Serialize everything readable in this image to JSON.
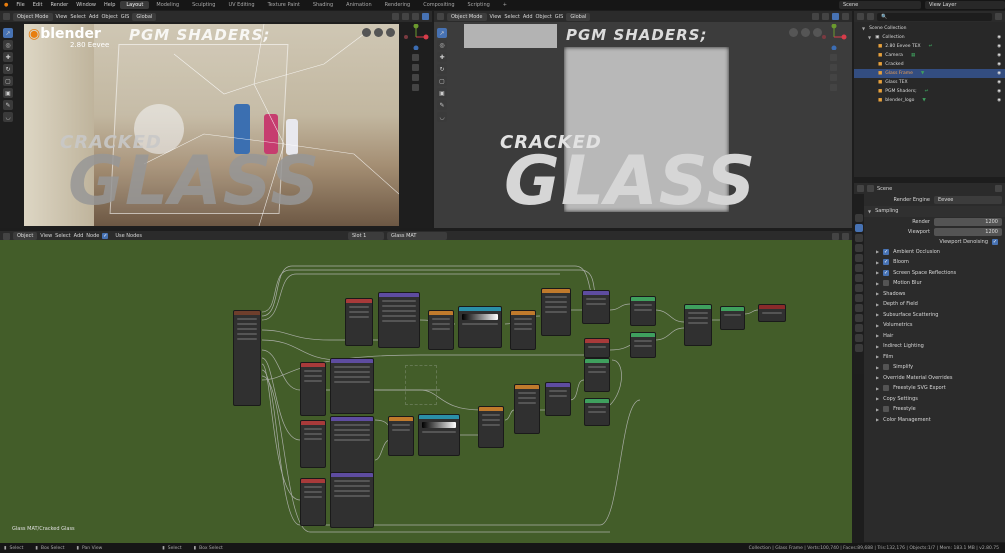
{
  "menu": {
    "items": [
      "File",
      "Edit",
      "Render",
      "Window",
      "Help"
    ]
  },
  "workspaces": [
    "Layout",
    "Modeling",
    "Sculpting",
    "UV Editing",
    "Texture Paint",
    "Shading",
    "Animation",
    "Rendering",
    "Compositing",
    "Scripting"
  ],
  "scene": {
    "name": "Scene",
    "view_layer": "View Layer"
  },
  "viewport_left": {
    "mode": "Object Mode",
    "menus": [
      "View",
      "Select",
      "Add",
      "Object",
      "GIS"
    ],
    "orientation": "Global",
    "logo": "blender",
    "version": "2.80 Eevee",
    "title": "PGM SHADERS;",
    "label_small": "CRACKED",
    "label_big": "GLASS"
  },
  "viewport_right": {
    "mode": "Object Mode",
    "menus": [
      "View",
      "Select",
      "Add",
      "Object",
      "GIS"
    ],
    "orientation": "Global",
    "title": "PGM SHADERS;",
    "label_small": "CRACKED",
    "label_big": "GLASS"
  },
  "node_editor": {
    "type": "Object",
    "menus": [
      "View",
      "Select",
      "Add",
      "Node"
    ],
    "use_nodes": "Use Nodes",
    "slot": "Slot 1",
    "material": "Glass MAT",
    "breadcrumb": "Glass MAT/Cracked Glass"
  },
  "outliner": {
    "root": "Scene Collection",
    "items": [
      "Collection",
      "2.80 Eevee TEX",
      "Camera",
      "Cracked",
      "Glass Frame",
      "Glass TEX",
      "PGM Shaders;",
      "blender_logo"
    ]
  },
  "properties": {
    "scene_label": "Scene",
    "render_engine_label": "Render Engine",
    "render_engine": "Eevee",
    "sampling": "Sampling",
    "render_label": "Render",
    "render_value": "1200",
    "viewport_label": "Viewport",
    "viewport_value": "1200",
    "viewport_denoising": "Viewport Denoising",
    "panels": [
      "Ambient Occlusion",
      "Bloom",
      "Screen Space Reflections",
      "Motion Blur",
      "Shadows",
      "Depth of Field",
      "Subsurface Scattering",
      "Volumetrics",
      "Hair",
      "Indirect Lighting",
      "Film",
      "Simplify",
      "Override Material Overrides",
      "Freestyle SVG Export",
      "Copy Settings",
      "Freestyle",
      "Color Management"
    ]
  },
  "statusbar": {
    "hints": [
      "Select",
      "Box Select",
      "Pan View",
      "Select",
      "Box Select"
    ],
    "info": "Collection | Glass Frame | Verts:100,740 | Faces:89,688 | Tris:132,176 | Objects:1/7 | Mem: 183.1 MB | v2.80.75"
  }
}
